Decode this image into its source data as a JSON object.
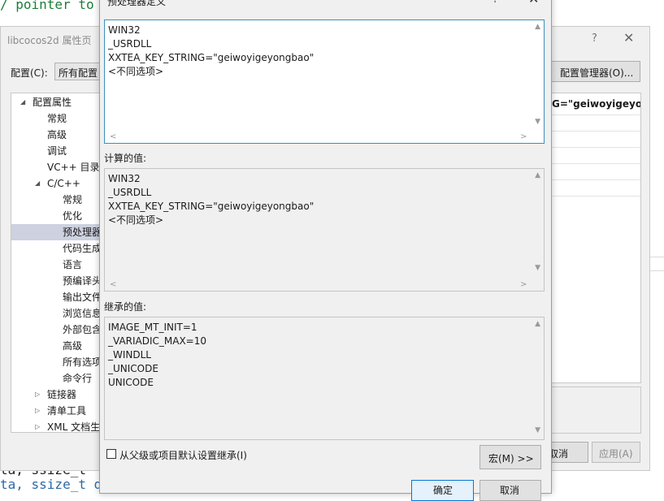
{
  "editor": {
    "top_line": "/ pointer to",
    "bottom_line_1": "ta, ssize_t",
    "bottom_line_2": "ta, ssize_t d"
  },
  "property_window": {
    "title": "libcocos2d 属性页",
    "help": "?",
    "close": "✕",
    "config_label": "配置(C):",
    "config_value": "所有配置",
    "config_manager_button": "配置管理器(O)...",
    "tree": [
      {
        "label": "配置属性",
        "expanded": true
      },
      {
        "label": "常规"
      },
      {
        "label": "高级"
      },
      {
        "label": "调试"
      },
      {
        "label": "VC++ 目录"
      },
      {
        "label": "C/C++",
        "expanded": true
      },
      {
        "label": "常规"
      },
      {
        "label": "优化"
      },
      {
        "label": "预处理器",
        "selected": true
      },
      {
        "label": "代码生成"
      },
      {
        "label": "语言"
      },
      {
        "label": "预编译头"
      },
      {
        "label": "输出文件"
      },
      {
        "label": "浏览信息"
      },
      {
        "label": "外部包含"
      },
      {
        "label": "高级"
      },
      {
        "label": "所有选项"
      },
      {
        "label": "命令行"
      },
      {
        "label": "链接器",
        "expanded": false
      },
      {
        "label": "清单工具",
        "expanded": false
      },
      {
        "label": "XML 文档生",
        "expanded": false
      }
    ],
    "grid_value_snippet": "G=\"geiwoyigeyong",
    "cancel_button": "取消",
    "apply_button": "应用(A)"
  },
  "dialog": {
    "title": "预处理器定义",
    "help": "?",
    "close": "✕",
    "editable_lines": [
      "WIN32",
      "_USRDLL",
      "XXTEA_KEY_STRING=\"geiwoyigeyongbao\"",
      "<不同选项>"
    ],
    "computed_label": "计算的值:",
    "computed_lines": [
      "WIN32",
      "_USRDLL",
      "XXTEA_KEY_STRING=\"geiwoyigeyongbao\"",
      "<不同选项>"
    ],
    "inherited_label": "继承的值:",
    "inherited_lines": [
      "IMAGE_MT_INIT=1",
      "_VARIADIC_MAX=10",
      "_WINDLL",
      "_UNICODE",
      "UNICODE"
    ],
    "inherit_checkbox_label": "从父级或项目默认设置继承(I)",
    "inherit_checked": false,
    "macro_button": "宏(M) >>",
    "ok_button": "确定",
    "cancel_button": "取消"
  },
  "icons": {
    "scroll_up": "▲",
    "scroll_down": "▼",
    "scroll_left": "<",
    "scroll_right": ">",
    "tree_expanded": "◢",
    "tree_collapsed": "▷"
  }
}
